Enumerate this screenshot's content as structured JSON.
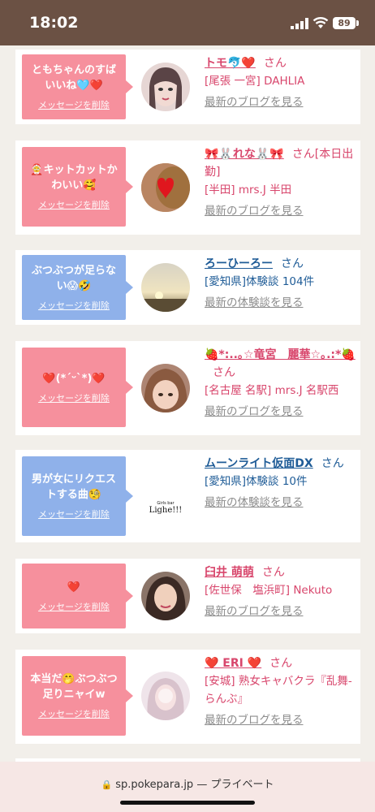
{
  "status": {
    "time": "18:02",
    "battery": "89"
  },
  "items": [
    {
      "message": "ともちゃんのすばいいね🩵❤️",
      "delete": "メッセージを削除",
      "name": "トモ🐬❤️",
      "san": "さん",
      "shop": "[尾張 一宮] DAHLIA",
      "link": "最新のブログを見る",
      "bubble_color": "#f6909d",
      "text_color": "#d8466c"
    },
    {
      "message": "🤶キットカットかわいい🥰",
      "delete": "メッセージを削除",
      "name": "🎀🐰れな🐰🎀",
      "san": "さん[本日出勤]",
      "shop": "[半田] mrs.J 半田",
      "link": "最新のブログを見る",
      "bubble_color": "#f6909d",
      "text_color": "#d8466c"
    },
    {
      "message": "ぶつぶつが足らない😱🤣",
      "delete": "メッセージを削除",
      "name": "ろーひーろー",
      "san": "さん",
      "shop": "[愛知県]体験談 104件",
      "link": "最新の体験談を見る",
      "bubble_color": "#8fb1ea",
      "text_color": "#1f5c97"
    },
    {
      "message": "❤️(*´ᵕ`*)❤️",
      "delete": "メッセージを削除",
      "name": "🍓*:..｡☆竜宮　麗華☆｡.:*🍓",
      "san": "さん",
      "shop": "[名古屋 名駅] mrs.J 名駅西",
      "link": "最新のブログを見る",
      "bubble_color": "#f6909d",
      "text_color": "#d8466c"
    },
    {
      "message": "男が女にリクエストする曲🧐",
      "delete": "メッセージを削除",
      "name": "ムーンライト仮面DX",
      "san": "さん",
      "shop": "[愛知県]体験談 10件",
      "link": "最新の体験談を見る",
      "bubble_color": "#8fb1ea",
      "text_color": "#1f5c97"
    },
    {
      "message": "❤️",
      "delete": "メッセージを削除",
      "name": "臼井 萌萌",
      "san": "さん",
      "shop": "[佐世保　塩浜町] Nekuto",
      "link": "最新のブログを見る",
      "bubble_color": "#f6909d",
      "text_color": "#d8466c"
    },
    {
      "message": "本当だ🤭ぶつぶつ足りニャイw",
      "delete": "メッセージを削除",
      "name": "❤️ ERI ❤️",
      "san": "さん",
      "shop": "[安城] 熟女キャバクラ『乱舞-らんぶ』",
      "link": "最新のブログを見る",
      "bubble_color": "#f6909d",
      "text_color": "#d8466c"
    }
  ],
  "avatar_logo": {
    "small": "Girls bar",
    "big": "Lighe!!!"
  },
  "footer": {
    "url": "sp.pokepara.jp — プライベート"
  }
}
